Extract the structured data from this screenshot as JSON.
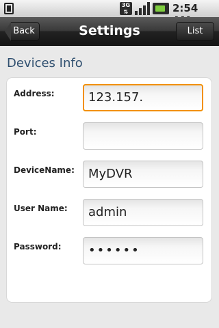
{
  "status_bar": {
    "network_label": "3G",
    "time": "2:54 AM",
    "icons": [
      "sim-card-icon",
      "network-3g-icon",
      "signal-strength-icon",
      "battery-charging-icon"
    ]
  },
  "header": {
    "title": "Settings",
    "back_label": "Back",
    "list_label": "List"
  },
  "section": {
    "title": "Devices Info"
  },
  "fields": [
    {
      "label": "Address:",
      "value": "123.157.",
      "focused": true
    },
    {
      "label": "Port:",
      "value": ""
    },
    {
      "label": "DeviceName:",
      "value": "MyDVR"
    },
    {
      "label": "User Name:",
      "value": "admin"
    },
    {
      "label": "Password:",
      "value": "••••••"
    }
  ],
  "colors": {
    "title_bar": "#222222",
    "focus_border": "#f29000",
    "section_title": "#2f4f6f",
    "battery": "#7fce3f"
  }
}
